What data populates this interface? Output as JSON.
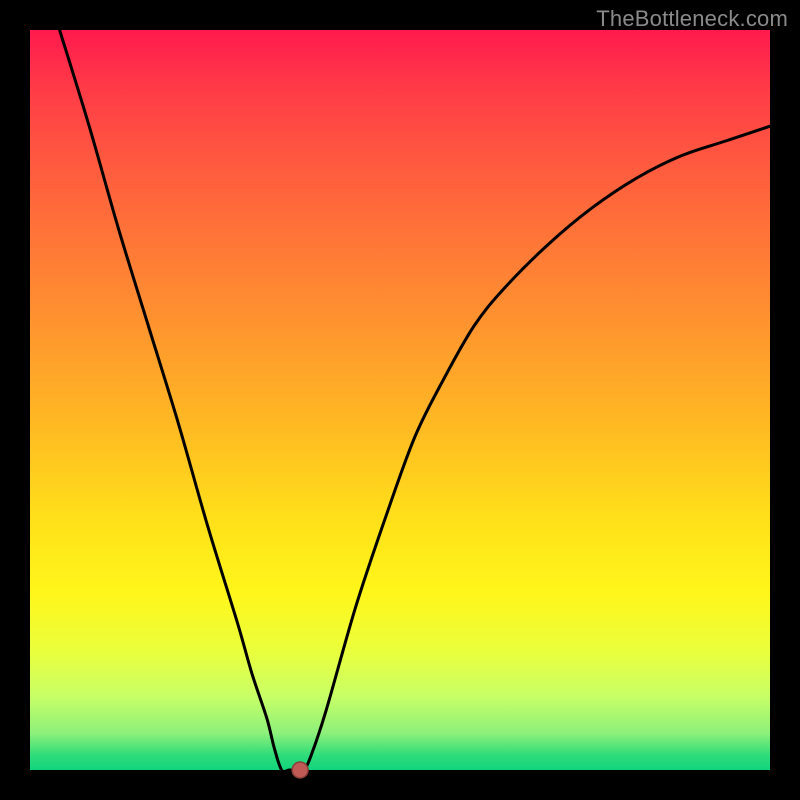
{
  "watermark_text": "TheBottleneck.com",
  "colors": {
    "frame": "#000000",
    "curve": "#000000",
    "marker_fill": "#c05a55",
    "marker_stroke": "#8a3e3a",
    "gradient_top": "#ff1a4d",
    "gradient_bottom": "#11d47c"
  },
  "chart_data": {
    "type": "line",
    "title": "",
    "xlabel": "",
    "ylabel": "",
    "xlim": [
      0,
      100
    ],
    "ylim": [
      0,
      100
    ],
    "grid": false,
    "legend": false,
    "series": [
      {
        "name": "bottleneck-curve",
        "x": [
          4,
          8,
          12,
          16,
          20,
          24,
          28,
          30,
          32,
          33,
          34,
          35,
          36,
          37,
          38,
          40,
          44,
          48,
          52,
          56,
          60,
          64,
          70,
          76,
          82,
          88,
          94,
          100
        ],
        "values": [
          100,
          87,
          73,
          60,
          47,
          33,
          20,
          13,
          7,
          3,
          0,
          0,
          0,
          0,
          2,
          8,
          22,
          34,
          45,
          53,
          60,
          65,
          71,
          76,
          80,
          83,
          85,
          87
        ]
      }
    ],
    "marker": {
      "x": 36.5,
      "y": 0,
      "radius_px": 8
    },
    "notes": "Axes have no visible tick labels in the image; values above are read as percentages of the plot area (0 at bottom-left)."
  }
}
